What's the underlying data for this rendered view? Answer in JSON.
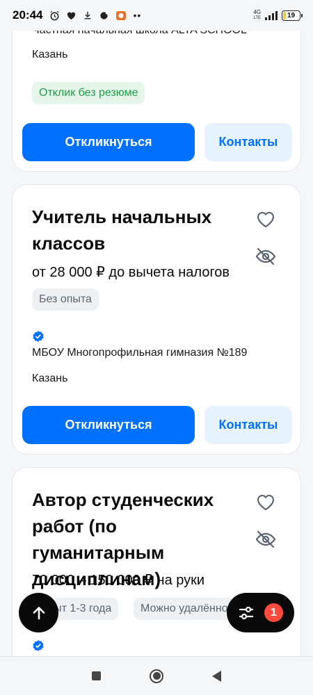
{
  "status_bar": {
    "time": "20:44",
    "network_top": "4G",
    "network_bottom": "LTE",
    "battery": "19"
  },
  "cards": [
    {
      "company": "Частная начальная школа ALTA SCHOOL",
      "city": "Казань",
      "tags": [
        "Отклик без резюме"
      ],
      "apply_label": "Откликнуться",
      "contacts_label": "Контакты"
    },
    {
      "title": "Учитель начальных классов",
      "salary": "от 28 000 ₽ до вычета налогов",
      "tags": [
        "Без опыта"
      ],
      "company": "МБОУ Многопрофильная гимназия №189",
      "city": "Казань",
      "apply_label": "Откликнуться",
      "contacts_label": "Контакты"
    },
    {
      "title": "Автор студенческих работ (по гуманитарным дисциплинам)",
      "salary": "70 000 – 150 000 ₽ на руки",
      "tags": [
        "Опыт 1-3 года",
        "Можно удалённо"
      ]
    }
  ],
  "filter": {
    "badge_count": "1"
  },
  "icons": {
    "favorite": "heart-icon",
    "hide": "eye-off-icon",
    "verified": "verified-badge-icon",
    "scroll_up": "arrow-up-icon",
    "filter": "sliders-icon"
  },
  "colors": {
    "accent": "#0070ff",
    "accent_light": "#e7f2ff",
    "success_bg": "#e5f5ea",
    "success_text": "#1e9e4a",
    "badge": "#ff4a3d"
  }
}
